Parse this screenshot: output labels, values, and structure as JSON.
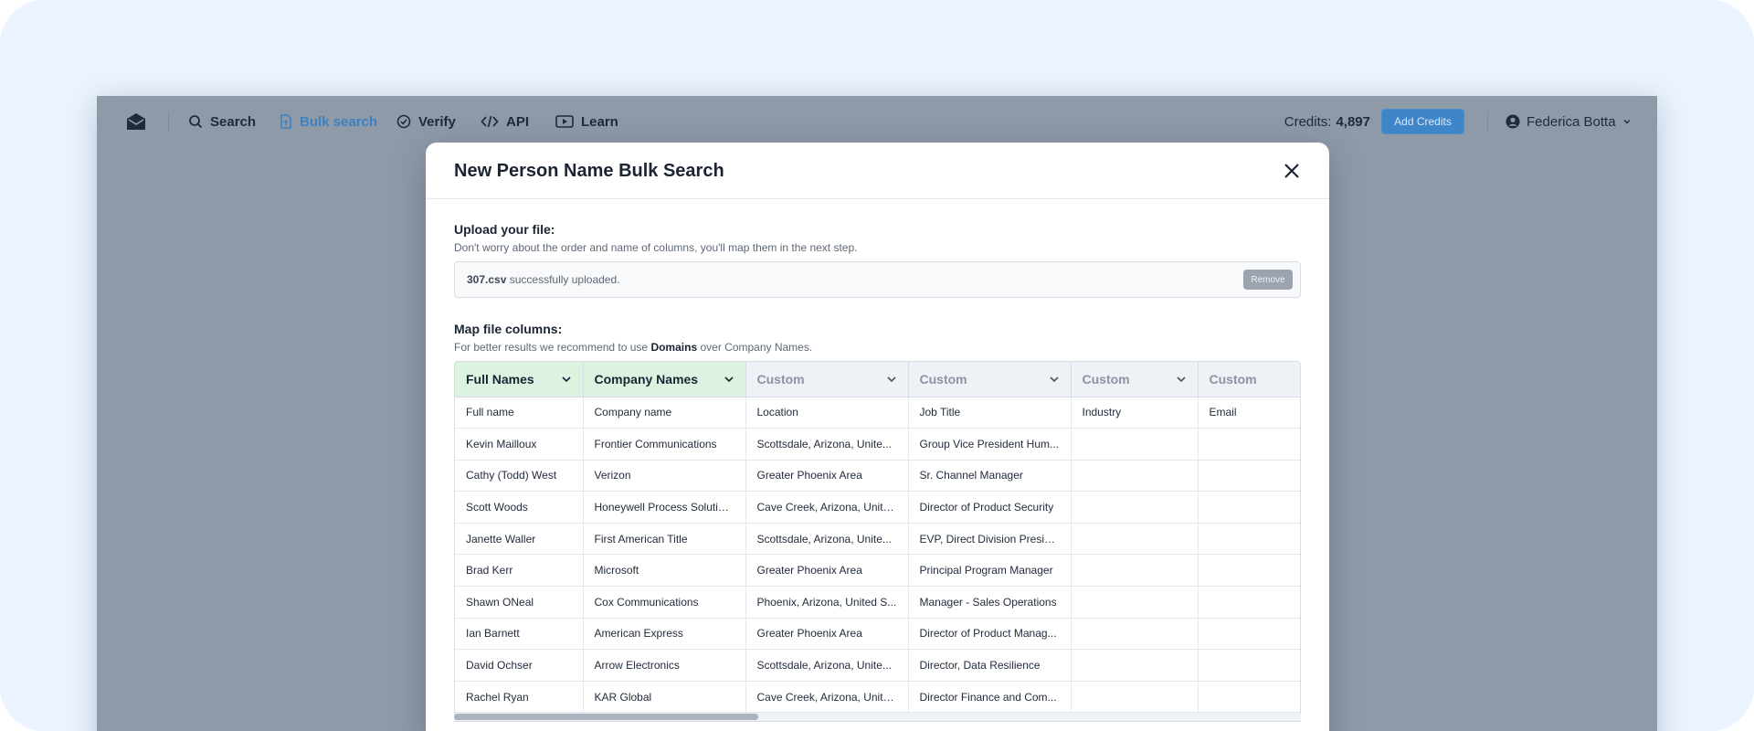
{
  "nav": {
    "items": [
      {
        "label": "Search",
        "icon": "search-icon"
      },
      {
        "label": "Bulk search",
        "icon": "file-upload-icon",
        "active": true
      },
      {
        "label": "Verify",
        "icon": "check-circle-icon"
      },
      {
        "label": "API",
        "icon": "code-icon"
      },
      {
        "label": "Learn",
        "icon": "play-icon"
      }
    ],
    "credits_label": "Credits:",
    "credits_value": "4,897",
    "add_credits": "Add Credits",
    "user_name": "Federica Botta"
  },
  "modal": {
    "title": "New Person Name Bulk Search",
    "upload_title": "Upload your file:",
    "upload_sub": "Don't worry about the order and name of columns, you'll map them in the next step.",
    "upload_filename": "307.csv",
    "upload_status": "successfully uploaded.",
    "remove_label": "Remove",
    "map_title": "Map file columns:",
    "map_sub_prefix": "For better results we recommend to use",
    "map_sub_bold": "Domains",
    "map_sub_suffix": "over Company Names."
  },
  "table": {
    "headers": [
      {
        "label": "Full Names",
        "mapped": true
      },
      {
        "label": "Company Names",
        "mapped": true
      },
      {
        "label": "Custom",
        "mapped": false
      },
      {
        "label": "Custom",
        "mapped": false
      },
      {
        "label": "Custom",
        "mapped": false
      },
      {
        "label": "Custom",
        "mapped": false
      }
    ],
    "rows": [
      [
        "Full name",
        "Company name",
        "Location",
        "Job Title",
        "Industry",
        "Email"
      ],
      [
        "Kevin Mailloux",
        "Frontier Communications",
        "Scottsdale, Arizona, Unite...",
        "Group Vice President Hum...",
        "",
        ""
      ],
      [
        "Cathy (Todd) West",
        "Verizon",
        "Greater Phoenix Area",
        "Sr. Channel Manager",
        "",
        ""
      ],
      [
        "Scott Woods",
        "Honeywell Process Solutions",
        "Cave Creek, Arizona, Unite...",
        "Director of Product Security",
        "",
        ""
      ],
      [
        "Janette Waller",
        "First American Title",
        "Scottsdale, Arizona, Unite...",
        "EVP, Direct Division Presid...",
        "",
        ""
      ],
      [
        "Brad Kerr",
        "Microsoft",
        "Greater Phoenix Area",
        "Principal Program Manager",
        "",
        ""
      ],
      [
        "Shawn ONeal",
        "Cox Communications",
        "Phoenix, Arizona, United S...",
        "Manager - Sales Operations",
        "",
        ""
      ],
      [
        "Ian Barnett",
        "American Express",
        "Greater Phoenix Area",
        "Director of Product Manag...",
        "",
        ""
      ],
      [
        "David Ochser",
        "Arrow Electronics",
        "Scottsdale, Arizona, Unite...",
        "Director, Data Resilience",
        "",
        ""
      ],
      [
        "Rachel Ryan",
        "KAR Global",
        "Cave Creek, Arizona, Unite...",
        "Director Finance and Com...",
        "",
        ""
      ]
    ]
  },
  "colors": {
    "accent": "#3f86c9",
    "mapped_header": "#dcf3e2",
    "overlay": "#8f9aa9",
    "outer_bg": "#ebf4fe"
  }
}
